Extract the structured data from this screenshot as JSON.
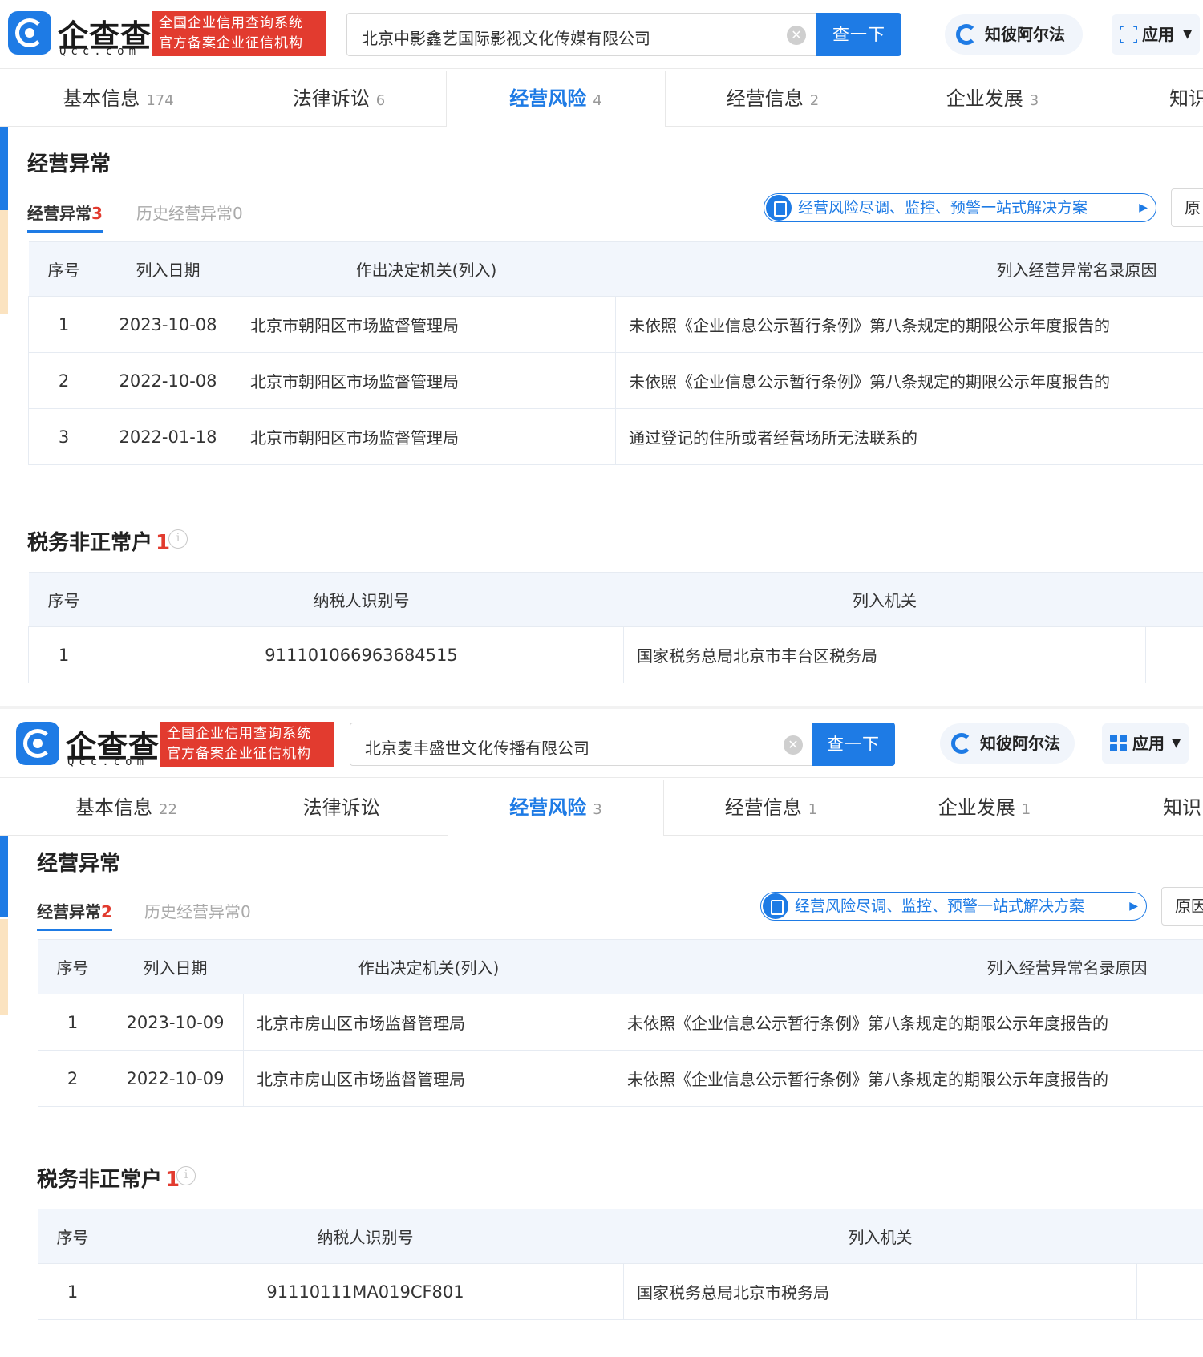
{
  "colors": {
    "accent": "#1e7be5",
    "danger": "#e23b2f",
    "badge_bg": "#e23b2f",
    "table_header_bg": "#f2f6fc"
  },
  "screens": [
    {
      "logo": {
        "name": "企查查",
        "domain": "Qcc.com",
        "badge_line1": "全国企业信用查询系统",
        "badge_line2": "官方备案企业征信机构"
      },
      "search": {
        "value": "北京中影鑫艺国际影视文化传媒有限公司",
        "clear_icon": "clear-icon",
        "button": "查一下"
      },
      "pill_label": "知彼阿尔法",
      "app_label": "应用",
      "tabs": [
        {
          "label": "基本信息",
          "count": "174"
        },
        {
          "label": "法律诉讼",
          "count": "6"
        },
        {
          "label": "经营风险",
          "count": "4"
        },
        {
          "label": "经营信息",
          "count": "2"
        },
        {
          "label": "企业发展",
          "count": "3"
        },
        {
          "label": "知识",
          "count": ""
        }
      ],
      "abnormal": {
        "title": "经营异常",
        "subtab_active": "经营异常",
        "subtab_active_count": "3",
        "subtab_history": "历史经营异常",
        "subtab_history_count": "0",
        "promo": "经营风险尽调、监控、预警一站式解决方案",
        "side_button": "原",
        "headers": [
          "序号",
          "列入日期",
          "作出决定机关(列入)",
          "列入经营异常名录原因"
        ],
        "rows": [
          [
            "1",
            "2023-10-08",
            "北京市朝阳区市场监督管理局",
            "未依照《企业信息公示暂行条例》第八条规定的期限公示年度报告的"
          ],
          [
            "2",
            "2022-10-08",
            "北京市朝阳区市场监督管理局",
            "未依照《企业信息公示暂行条例》第八条规定的期限公示年度报告的"
          ],
          [
            "3",
            "2022-01-18",
            "北京市朝阳区市场监督管理局",
            "通过登记的住所或者经营场所无法联系的"
          ]
        ]
      },
      "tax": {
        "title": "税务非正常户",
        "count": "1",
        "info_icon": "i",
        "headers": [
          "序号",
          "纳税人识别号",
          "列入机关"
        ],
        "rows": [
          [
            "1",
            "911101066963684515",
            "国家税务总局北京市丰台区税务局"
          ]
        ]
      }
    },
    {
      "logo": {
        "name": "企查查",
        "domain": "Qcc.com",
        "badge_line1": "全国企业信用查询系统",
        "badge_line2": "官方备案企业征信机构"
      },
      "search": {
        "value": "北京麦丰盛世文化传播有限公司",
        "clear_icon": "clear-icon",
        "button": "查一下"
      },
      "pill_label": "知彼阿尔法",
      "app_label": "应用",
      "tabs": [
        {
          "label": "基本信息",
          "count": "22"
        },
        {
          "label": "法律诉讼",
          "count": ""
        },
        {
          "label": "经营风险",
          "count": "3"
        },
        {
          "label": "经营信息",
          "count": "1"
        },
        {
          "label": "企业发展",
          "count": "1"
        },
        {
          "label": "知识",
          "count": ""
        }
      ],
      "abnormal": {
        "title": "经营异常",
        "subtab_active": "经营异常",
        "subtab_active_count": "2",
        "subtab_history": "历史经营异常",
        "subtab_history_count": "0",
        "promo": "经营风险尽调、监控、预警一站式解决方案",
        "side_button": "原因",
        "headers": [
          "序号",
          "列入日期",
          "作出决定机关(列入)",
          "列入经营异常名录原因"
        ],
        "rows": [
          [
            "1",
            "2023-10-09",
            "北京市房山区市场监督管理局",
            "未依照《企业信息公示暂行条例》第八条规定的期限公示年度报告的"
          ],
          [
            "2",
            "2022-10-09",
            "北京市房山区市场监督管理局",
            "未依照《企业信息公示暂行条例》第八条规定的期限公示年度报告的"
          ]
        ]
      },
      "tax": {
        "title": "税务非正常户",
        "count": "1",
        "info_icon": "i",
        "headers": [
          "序号",
          "纳税人识别号",
          "列入机关"
        ],
        "rows": [
          [
            "1",
            "91110111MA019CF801",
            "国家税务总局北京市税务局"
          ]
        ]
      }
    }
  ]
}
